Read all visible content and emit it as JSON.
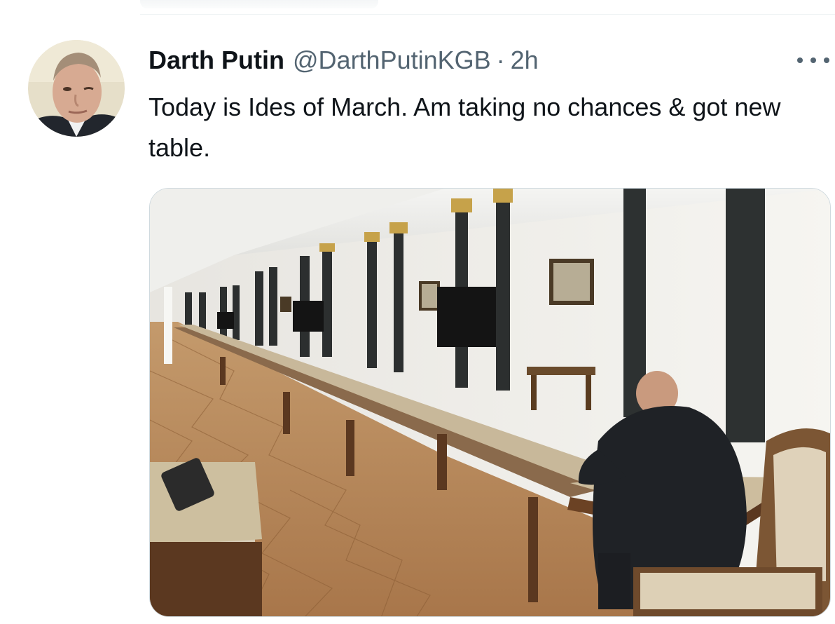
{
  "tweet": {
    "author_name": "Darth Putin",
    "author_handle": "@DarthPutinKGB",
    "separator": "·",
    "time": "2h",
    "text": "Today is Ides of March. Am taking no chances & got new table.",
    "avatar_icon": "profile-avatar",
    "more_icon": "more-dots-icon",
    "media_description_icon": "attached-photo"
  },
  "colors": {
    "text_primary": "#0f1419",
    "text_secondary": "#536471",
    "border": "#cfd9de"
  }
}
